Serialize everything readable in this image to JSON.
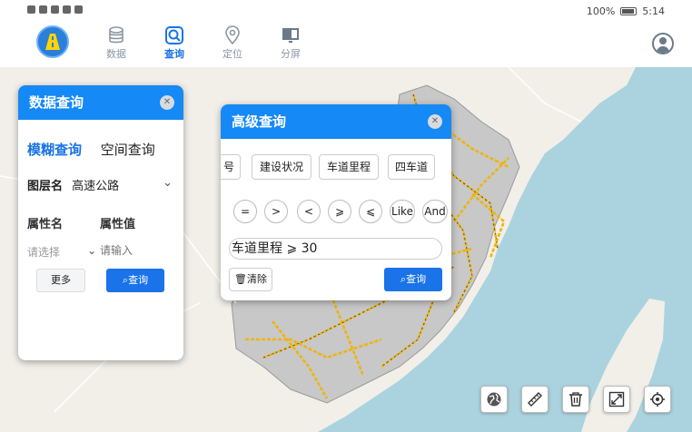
{
  "status_bar": {
    "battery": "100%",
    "time": "5:14"
  },
  "nav": {
    "tabs": [
      {
        "label": "数据",
        "icon": "database-icon"
      },
      {
        "label": "查询",
        "icon": "search-query-icon"
      },
      {
        "label": "定位",
        "icon": "location-pin-icon"
      },
      {
        "label": "分屏",
        "icon": "split-screen-icon"
      }
    ],
    "active_tab": "查询"
  },
  "data_query_panel": {
    "title": "数据查询",
    "modes": [
      "模糊查询",
      "空间查询"
    ],
    "active_mode": "模糊查询",
    "layer_label": "图层名",
    "layer_value": "高速公路",
    "attr_name_label": "属性名",
    "attr_value_label": "属性值",
    "attr_select_placeholder": "请选择",
    "attr_input_placeholder": "请输入",
    "more_label": "更多",
    "query_label": "查询"
  },
  "advanced_query_panel": {
    "title": "高级查询",
    "fields": [
      "号",
      "建设状况",
      "车道里程",
      "四车道"
    ],
    "operators": [
      "=",
      ">",
      "<",
      "⩾",
      "⩽",
      "Like",
      "And"
    ],
    "expression": "车道里程 ⩾ 30",
    "clear_label": "清除",
    "query_label": "查询"
  },
  "tools": [
    "globe-icon",
    "ruler-icon",
    "trash-icon",
    "fullscreen-icon",
    "locate-icon"
  ],
  "colors": {
    "accent": "#1589f5",
    "button": "#1a73e8",
    "sea": "#aad3df",
    "land": "#f2efe9",
    "highlight_region": "#c8c8c8",
    "road": "#f0b400"
  }
}
